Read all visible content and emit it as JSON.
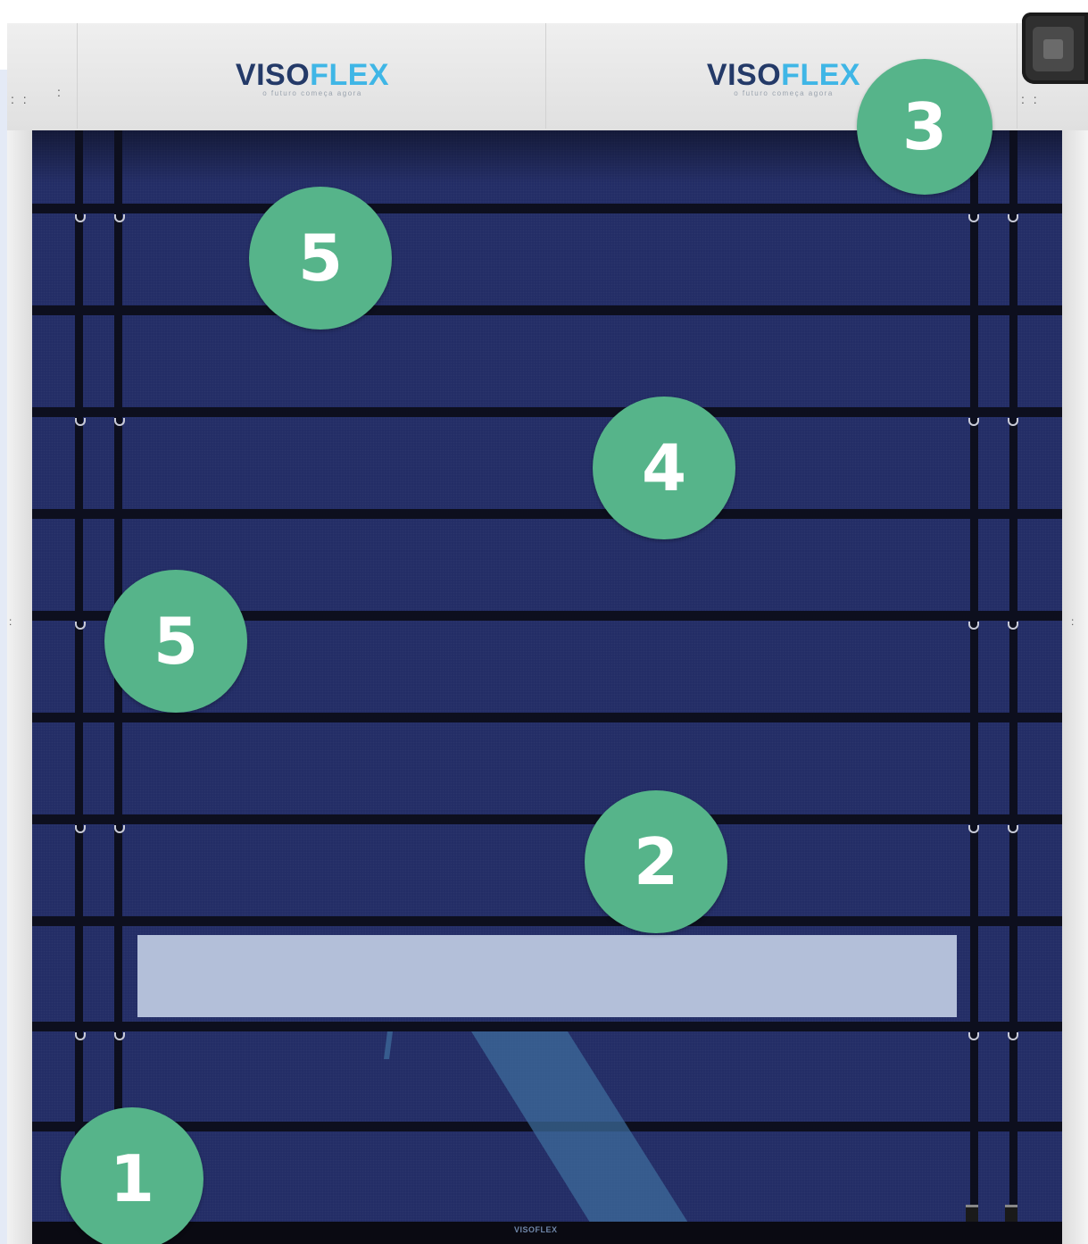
{
  "brand": {
    "name_part1": "VISO",
    "name_part2": "FLEX",
    "tagline": "o futuro começa agora",
    "bottom_logo": "VISOFLEX",
    "colors": {
      "viso": "#243a68",
      "flex": "#3fb6e6"
    }
  },
  "door": {
    "curtain_color": "#232d66",
    "window_color": "#b3bfd9",
    "badge_color": "#56b48a"
  },
  "callouts": [
    {
      "number": "1",
      "icon": "number-badge"
    },
    {
      "number": "2",
      "icon": "number-badge"
    },
    {
      "number": "3",
      "icon": "number-badge"
    },
    {
      "number": "4",
      "icon": "number-badge"
    },
    {
      "number": "5",
      "icon": "number-badge"
    },
    {
      "number": "5",
      "icon": "number-badge"
    }
  ]
}
